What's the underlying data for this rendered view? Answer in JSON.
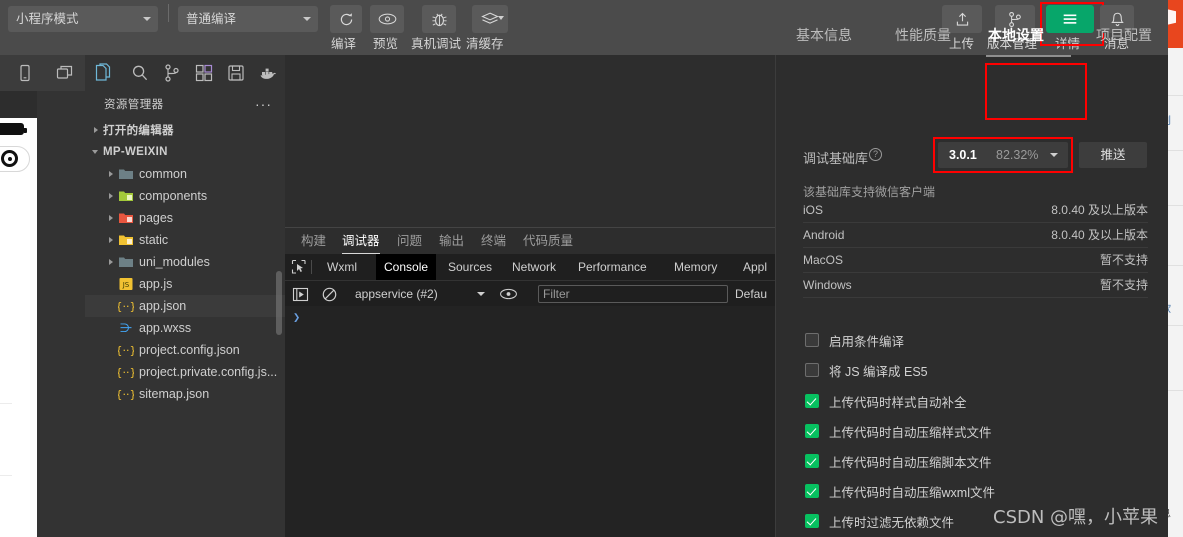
{
  "toolbar": {
    "mode_select": "小程序模式",
    "compile_select": "普通编译",
    "buttons": [
      {
        "label": "编译",
        "icon": "refresh-icon"
      },
      {
        "label": "预览",
        "icon": "eye-icon"
      },
      {
        "label": "真机调试",
        "icon": "bug-icon"
      },
      {
        "label": "清缓存",
        "icon": "layers-icon"
      }
    ],
    "right_buttons": [
      {
        "label": "上传",
        "icon": "upload-icon"
      },
      {
        "label": "版本管理",
        "icon": "branch-icon"
      },
      {
        "label": "详情",
        "icon": "hamburger-icon"
      },
      {
        "label": "消息",
        "icon": "bell-icon"
      }
    ],
    "accent_green": "#07a66a",
    "highlight_red": "#ff0000"
  },
  "activity_bar": {
    "sim_icons": [
      "phone-icon",
      "split-pane-icon"
    ],
    "icons": [
      "explorer-icon",
      "search-icon",
      "source-control-icon",
      "extensions-icon",
      "save-all-icon",
      "docker-icon"
    ]
  },
  "sidebar": {
    "title": "资源管理器",
    "more": "···",
    "sections": [
      {
        "label": "打开的编辑器",
        "expanded": false
      },
      {
        "label": "MP-WEIXIN",
        "expanded": true
      }
    ],
    "items": [
      {
        "label": "common",
        "type": "folder",
        "color": "#6d8086",
        "expanded": false
      },
      {
        "label": "components",
        "type": "folder",
        "color": "#a3c93a",
        "expanded": false
      },
      {
        "label": "pages",
        "type": "folder",
        "color": "#e8563f",
        "expanded": false
      },
      {
        "label": "static",
        "type": "folder",
        "color": "#f1c232",
        "expanded": false
      },
      {
        "label": "uni_modules",
        "type": "folder",
        "color": "#6d8086",
        "expanded": false
      },
      {
        "label": "app.js",
        "type": "js",
        "color": "#f1c232"
      },
      {
        "label": "app.json",
        "type": "json",
        "color": "#f1c232",
        "selected": true
      },
      {
        "label": "app.wxss",
        "type": "css",
        "color": "#42a5f5"
      },
      {
        "label": "project.config.json",
        "type": "json",
        "color": "#f1c232"
      },
      {
        "label": "project.private.config.js...",
        "type": "json",
        "color": "#f1c232"
      },
      {
        "label": "sitemap.json",
        "type": "json",
        "color": "#f1c232"
      }
    ]
  },
  "debugger": {
    "panel_tabs": [
      {
        "label": "构建",
        "active": false
      },
      {
        "label": "调试器",
        "active": true
      },
      {
        "label": "问题",
        "active": false
      },
      {
        "label": "输出",
        "active": false
      },
      {
        "label": "终端",
        "active": false
      },
      {
        "label": "代码质量",
        "active": false
      }
    ],
    "devtools_tabs": [
      {
        "label": "Wxml",
        "active": false
      },
      {
        "label": "Console",
        "active": true
      },
      {
        "label": "Sources",
        "active": false
      },
      {
        "label": "Network",
        "active": false
      },
      {
        "label": "Performance",
        "active": false
      },
      {
        "label": "Memory",
        "active": false
      },
      {
        "label": "Appl",
        "active": false
      }
    ],
    "inspect_icon": "cursor-select-icon",
    "console": {
      "execute_icon": "execute-icon",
      "clear_icon": "clear-console-icon",
      "context": "appservice (#2)",
      "eye_icon": "eye-icon",
      "filter_placeholder": "Filter",
      "filter_value": "",
      "level": "Defau",
      "prompt": "❯"
    }
  },
  "details": {
    "tabs": [
      {
        "label": "基本信息",
        "active": false
      },
      {
        "label": "性能质量",
        "active": false
      },
      {
        "label": "本地设置",
        "active": true
      },
      {
        "label": "项目配置",
        "active": false
      }
    ],
    "base_library": {
      "label": "调试基础库",
      "help_icon": "help-icon",
      "version": "3.0.1",
      "percent": "82.32%",
      "push_button": "推送"
    },
    "support": {
      "note": "该基础库支持微信客户端",
      "rows": [
        {
          "os": "iOS",
          "value": "8.0.40 及以上版本"
        },
        {
          "os": "Android",
          "value": "8.0.40 及以上版本"
        },
        {
          "os": "MacOS",
          "value": "暂不支持"
        },
        {
          "os": "Windows",
          "value": "暂不支持"
        }
      ]
    },
    "options": [
      {
        "label": "启用条件编译",
        "checked": false
      },
      {
        "label": "将 JS 编译成 ES5",
        "checked": false
      },
      {
        "label": "上传代码时样式自动补全",
        "checked": true
      },
      {
        "label": "上传代码时自动压缩样式文件",
        "checked": true
      },
      {
        "label": "上传代码时自动压缩脚本文件",
        "checked": true
      },
      {
        "label": "上传代码时自动压缩wxml文件",
        "checked": true
      },
      {
        "label": "上传时过滤无依赖文件",
        "checked": true
      }
    ]
  },
  "watermark": "CSDN @嘿，小苹果"
}
